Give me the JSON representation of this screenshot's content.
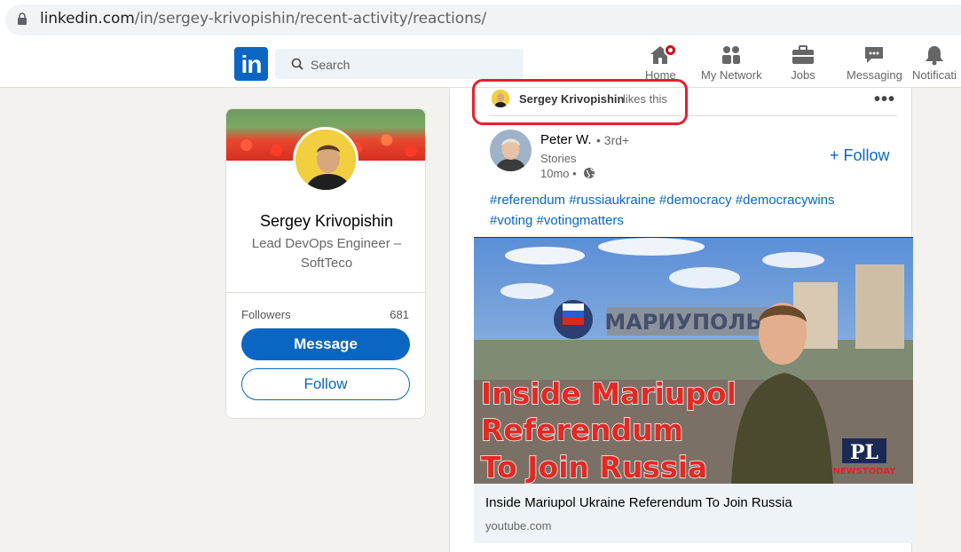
{
  "browser": {
    "url_host": "linkedin.com",
    "url_path": "/in/sergey-krivopishin/recent-activity/reactions/"
  },
  "nav": {
    "logo": "in",
    "search_placeholder": "Search",
    "items": [
      {
        "label": "Home",
        "icon": "home-icon"
      },
      {
        "label": "My Network",
        "icon": "network-icon"
      },
      {
        "label": "Jobs",
        "icon": "briefcase-icon"
      },
      {
        "label": "Messaging",
        "icon": "messaging-icon"
      },
      {
        "label": "Notificati",
        "icon": "bell-icon"
      }
    ],
    "colors": {
      "brand": "#0a66c2",
      "badge": "#cc1016"
    }
  },
  "profile": {
    "name": "Sergey Krivopishin",
    "headline": "Lead DevOps Engineer – SoftTeco",
    "followers_label": "Followers",
    "followers_count": "681",
    "message_button": "Message",
    "follow_button": "Follow"
  },
  "feed": {
    "activity": {
      "actor": "Sergey Krivopishin",
      "action": "likes this",
      "menu": "•••"
    },
    "post": {
      "author": "Peter W.",
      "degree": "• 3rd+",
      "subtitle": "Stories",
      "time": "10mo •",
      "follow_label": "+ Follow",
      "hashtags": "#referendum #russiaukraine #democracy #democracywins #voting #votingmatters",
      "image_caption_lines": [
        "Inside Mariupol",
        "Referendum",
        "To Join Russia"
      ],
      "image_sign": "МАРИУПОЛЬ",
      "image_logo": "PL",
      "image_logo_sub": "NEWSTODAY",
      "link_title": "Inside Mariupol Ukraine Referendum To Join Russia",
      "link_source": "youtube.com"
    }
  }
}
